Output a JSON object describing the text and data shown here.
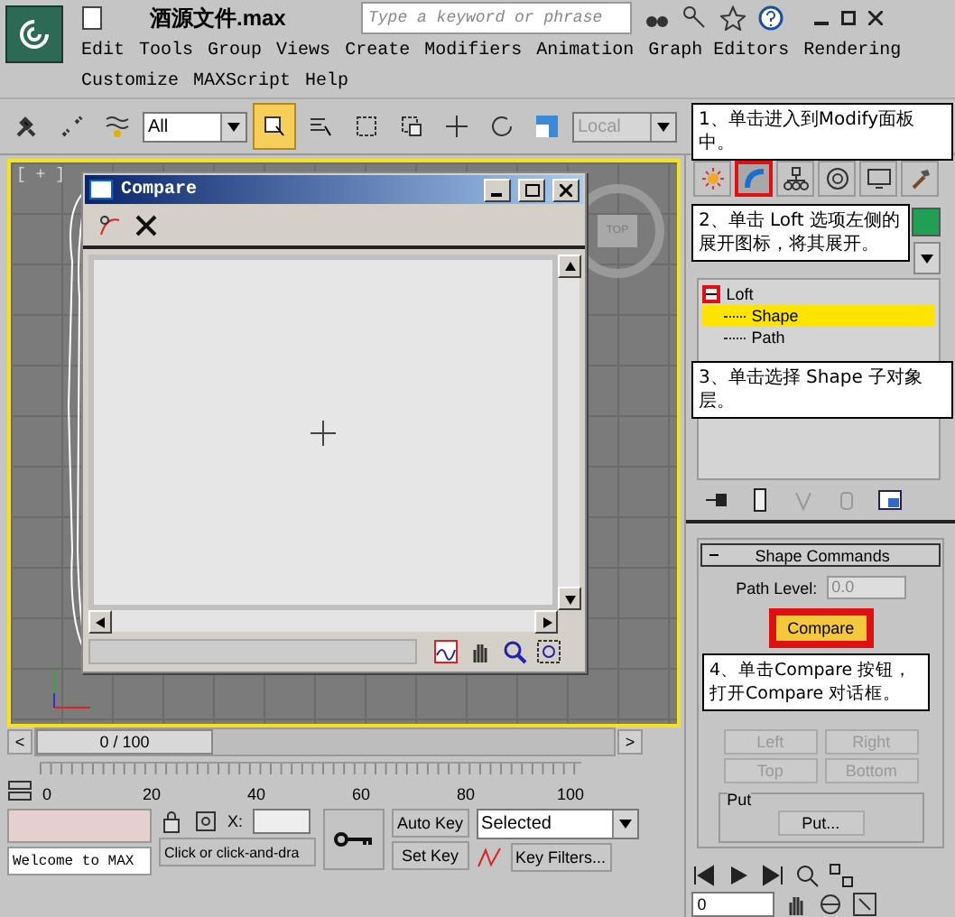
{
  "title_bar": {
    "file_name": "酒源文件.max",
    "search": {
      "placeholder": "Type a keyword or phrase"
    }
  },
  "menu": [
    "Edit",
    "Tools",
    "Group",
    "Views",
    "Create",
    "Modifiers",
    "Animation",
    "Graph Editors",
    "Rendering",
    "Customize",
    "MAXScript",
    "Help"
  ],
  "toolbar": {
    "selection_filter": "All",
    "coordinate_system": "Local"
  },
  "viewport": {
    "label": "[ + ]",
    "viewcube": "TOP"
  },
  "compare_dialog": {
    "title": "Compare"
  },
  "command_panel": {
    "tabs": [
      {
        "kind": "create",
        "selected": false,
        "highlighted": false
      },
      {
        "kind": "modify",
        "selected": true,
        "highlighted": true
      },
      {
        "kind": "hierarchy",
        "selected": false,
        "highlighted": false
      },
      {
        "kind": "motion",
        "selected": false,
        "highlighted": false
      },
      {
        "kind": "display",
        "selected": false,
        "highlighted": false
      },
      {
        "kind": "utilities",
        "selected": false,
        "highlighted": false
      }
    ],
    "stack": [
      {
        "label": "Loft",
        "expanded": true,
        "highlighted": true,
        "children": [
          {
            "label": "Shape",
            "selected": true
          },
          {
            "label": "Path",
            "selected": false
          }
        ]
      }
    ],
    "rollout": {
      "title": "Shape Commands",
      "path_level_label": "Path Level:",
      "path_level_value": "0.0",
      "compare_button": "Compare",
      "compare_highlighted": true,
      "align_buttons": [
        "Left",
        "Right",
        "Top",
        "Bottom"
      ],
      "put_group": "Put",
      "put_button": "Put..."
    }
  },
  "time_slider": {
    "prev": "<",
    "position": "0 / 100",
    "next": ">"
  },
  "track": {
    "ticks": [
      "0",
      "20",
      "40",
      "60",
      "80",
      "100"
    ]
  },
  "status": {
    "listener": "Welcome to MAX",
    "prompt": "Click or click-and-dra",
    "x_label": "X:",
    "auto_key": "Auto Key",
    "set_key": "Set Key",
    "key_mode": "Selected",
    "key_filters": "Key Filters...",
    "frame": "0"
  },
  "annotations": [
    {
      "text": "1、单击进入到Modify面板中。"
    },
    {
      "text": "2、单击 Loft 选项左侧的展开图标，将其展开。"
    },
    {
      "text": "3、单击选择 Shape 子对象层。"
    },
    {
      "text": "4、单击Compare 按钮，打开Compare 对话框。"
    }
  ]
}
